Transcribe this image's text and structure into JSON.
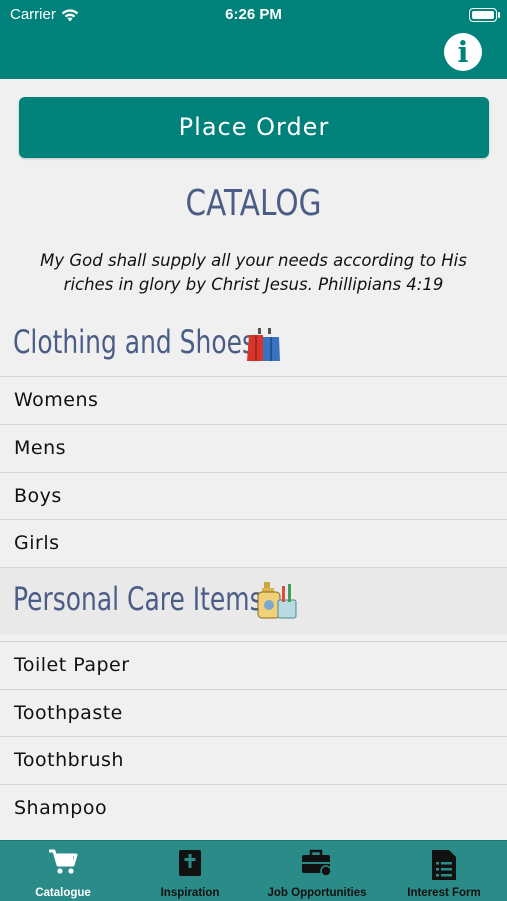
{
  "status_bar": {
    "carrier": "Carrier",
    "time": "6:26 PM"
  },
  "header": {
    "info_icon": "info-icon",
    "info_symbol": "i"
  },
  "place_order_label": "Place Order",
  "catalog_title": "CATALOG",
  "verse": "My God shall supply all your needs according to His riches in glory by Christ Jesus. Phillipians 4:19",
  "sections": [
    {
      "title": "Clothing and Shoes",
      "icon": "clothes-icon",
      "items": [
        "Womens",
        "Mens",
        "Boys",
        "Girls"
      ]
    },
    {
      "title": "Personal Care Items",
      "icon": "personal-care-icon",
      "items": [
        "Toilet Paper",
        "Toothpaste",
        "Toothbrush",
        "Shampoo"
      ]
    }
  ],
  "tabs": [
    {
      "label": "Catalogue",
      "icon": "cart-icon",
      "active": true
    },
    {
      "label": "Inspiration",
      "icon": "bible-icon",
      "active": false
    },
    {
      "label": "Job Opportunities",
      "icon": "briefcase-icon",
      "active": false
    },
    {
      "label": "Interest Form",
      "icon": "document-icon",
      "active": false
    }
  ],
  "colors": {
    "primary": "#00827b",
    "title": "#4b5d86",
    "tabbar": "#2b8b88"
  }
}
